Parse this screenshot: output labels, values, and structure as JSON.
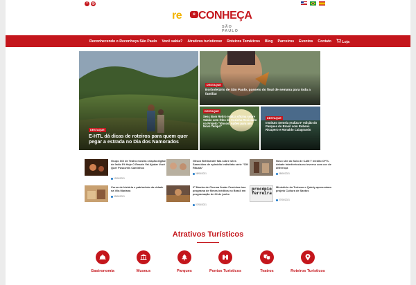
{
  "header": {
    "social_icons": [
      "facebook-icon",
      "instagram-icon"
    ],
    "social_glyphs": [
      "f",
      "◎"
    ],
    "flags": [
      "us-flag",
      "br-flag",
      "es-flag"
    ],
    "logo": {
      "part1": "re",
      "badge": "e",
      "part2": "CONHEÇA",
      "city": "SÃO PAULO"
    }
  },
  "nav": {
    "items": [
      "Reconhecendo o Reconheça São Paulo",
      "Você sabia?",
      "Atrativos turísticos",
      "Roteiros Temáticos",
      "Blog",
      "Parceiros",
      "Eventos",
      "Contato"
    ],
    "dropdown_marker": "▾",
    "cart_label": "Loja",
    "colors": {
      "brand_red": "#c4161c",
      "brand_yellow": "#f2b400"
    }
  },
  "hero": {
    "main": {
      "tag": "DESTAQUE",
      "title": "E-HTL dá dicas de roteiros para quem quer pegar a estrada no Dia dos Namorados"
    },
    "top_right": {
      "tag": "DESTAQUE",
      "title": "Borboletário de São Paulo, passeio do final de semana para toda a família!"
    },
    "bottom_left": {
      "tag": "DESTAQUE",
      "title": "Sesc Bom Retiro realiza oficina sobre Sabão com Óleo de Cozinha Reciclado no Projeto \"Idosos: Ações para um Novo Tempo\""
    },
    "bottom_right": {
      "tag": "DESTAQUE",
      "title": "Instituto Semeia realiza 5ª edição do Parques do Brasil com Rubens Ricupero e Ronaldo Caiagrando"
    }
  },
  "news": [
    {
      "title": "Grupo XIX de Teatro mostra criação digital de Índio Fê Hoje O Ensaio Vai Ajudar Você Quer Possíveis Caminhos",
      "date": "12/06/2021"
    },
    {
      "title": "Gilson Bettinardel fala sobre sites Sanecidos de episódio indistinta série \"CM Rituais\"",
      "date": "08/06/2021"
    },
    {
      "title": "Novo site do Solo de CAM T Inédito CFTL debate interferência no inverno com cor de diferença",
      "date": "08/06/2021"
    },
    {
      "title": "Curso de história e patrimônio da cidade na Vila Mariana",
      "date": "09/06/2021"
    },
    {
      "title": "2ª Mostra de Cinema Árabe Feminina traz programa de filmes inéditos no Brasil em programação de 24 de junho",
      "date": "07/06/2021"
    },
    {
      "title": "Ministério do Turismo e Quinty apresentam projeto Cultura de Santos",
      "date": "07/06/2021"
    }
  ],
  "news_thumb_text": "procópio ferreira",
  "attractions": {
    "title": "Atrativos Turísticos",
    "items": [
      {
        "label": "Gastronomia",
        "icon": "food-dome-icon"
      },
      {
        "label": "Museus",
        "icon": "museum-icon"
      },
      {
        "label": "Parques",
        "icon": "tree-icon"
      },
      {
        "label": "Pontos Turísticos",
        "icon": "binoculars-icon"
      },
      {
        "label": "Teatros",
        "icon": "theater-masks-icon"
      },
      {
        "label": "Roteiros Turísticos",
        "icon": "map-pin-icon"
      }
    ]
  }
}
